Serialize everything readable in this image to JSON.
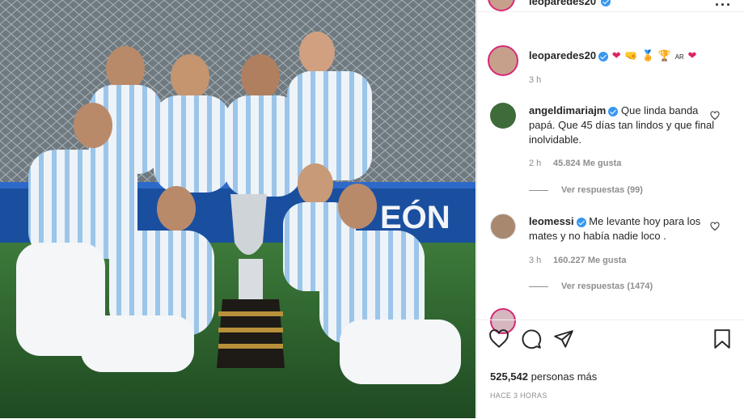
{
  "post": {
    "author": "leoparedes20",
    "caption_emojis": [
      "❤",
      "🤜",
      "🏅",
      "🏆",
      "AR",
      "❤"
    ],
    "caption_time": "3 h",
    "likes_prefix": "525,542",
    "likes_suffix": "personas más",
    "time_ago": "HACE 3 HORAS",
    "photo_banner": "EÓN"
  },
  "comments": [
    {
      "user": "angeldimariajm",
      "text": "Que linda banda papá. Que 45 días tan lindos y que final inolvidable.",
      "time": "2 h",
      "likes": "45.824 Me gusta",
      "replies": "Ver respuestas (99)"
    },
    {
      "user": "leomessi",
      "text": "Me levante hoy para los mates y no había nadie loco .",
      "time": "3 h",
      "likes": "160.227 Me gusta",
      "replies": "Ver respuestas (1474)"
    }
  ],
  "icons": {
    "like": "heart-icon",
    "comment": "comment-icon",
    "share": "share-icon",
    "save": "bookmark-icon",
    "more": "more-options-icon"
  },
  "colors": {
    "verified": "#3897f0",
    "heart": "#e0245e",
    "text": "#262626",
    "muted": "#8e8e8e"
  }
}
